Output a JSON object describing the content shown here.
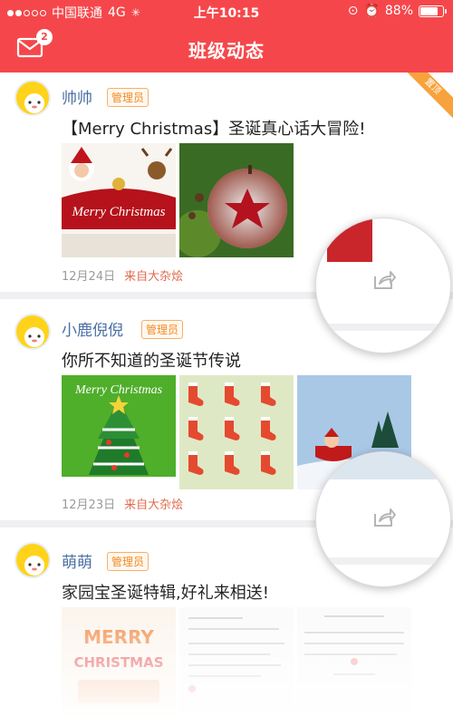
{
  "status_bar": {
    "carrier": "中国联通",
    "network": "4G",
    "time": "上午10:15",
    "battery_text": "88%",
    "battery_level": 0.88
  },
  "nav": {
    "title": "班级动态",
    "mail_badge": "2"
  },
  "colors": {
    "accent": "#f5474b",
    "name_blue": "#4a6fa5",
    "tag_orange": "#f08a24",
    "source_orange": "#e06b4e"
  },
  "posts": [
    {
      "name": "帅帅",
      "role": "管理员",
      "text": "【Merry Christmas】圣诞真心话大冒险!",
      "date": "12月24日",
      "source": "来自大杂烩",
      "image_icons": [
        "christmas-card-image",
        "frosted-apple-image"
      ],
      "image_text": [
        "Merry Christmas"
      ]
    },
    {
      "name": "小鹿倪倪",
      "role": "管理员",
      "text": "你所不知道的圣诞节传说",
      "date": "12月23日",
      "source": "来自大杂烩",
      "image_icons": [
        "christmas-tree-image",
        "stockings-grid-image",
        "santa-sleigh-image"
      ],
      "image_text": [
        "Merry Christmas"
      ]
    },
    {
      "name": "萌萌",
      "role": "管理员",
      "text": "家园宝圣诞特辑,好礼来相送!",
      "image_icons": [
        "merry-christmas-poster-image",
        "document-page-image",
        "document-page-image"
      ],
      "image_text": [
        "MERRY",
        "CHRISTMAS"
      ]
    }
  ]
}
